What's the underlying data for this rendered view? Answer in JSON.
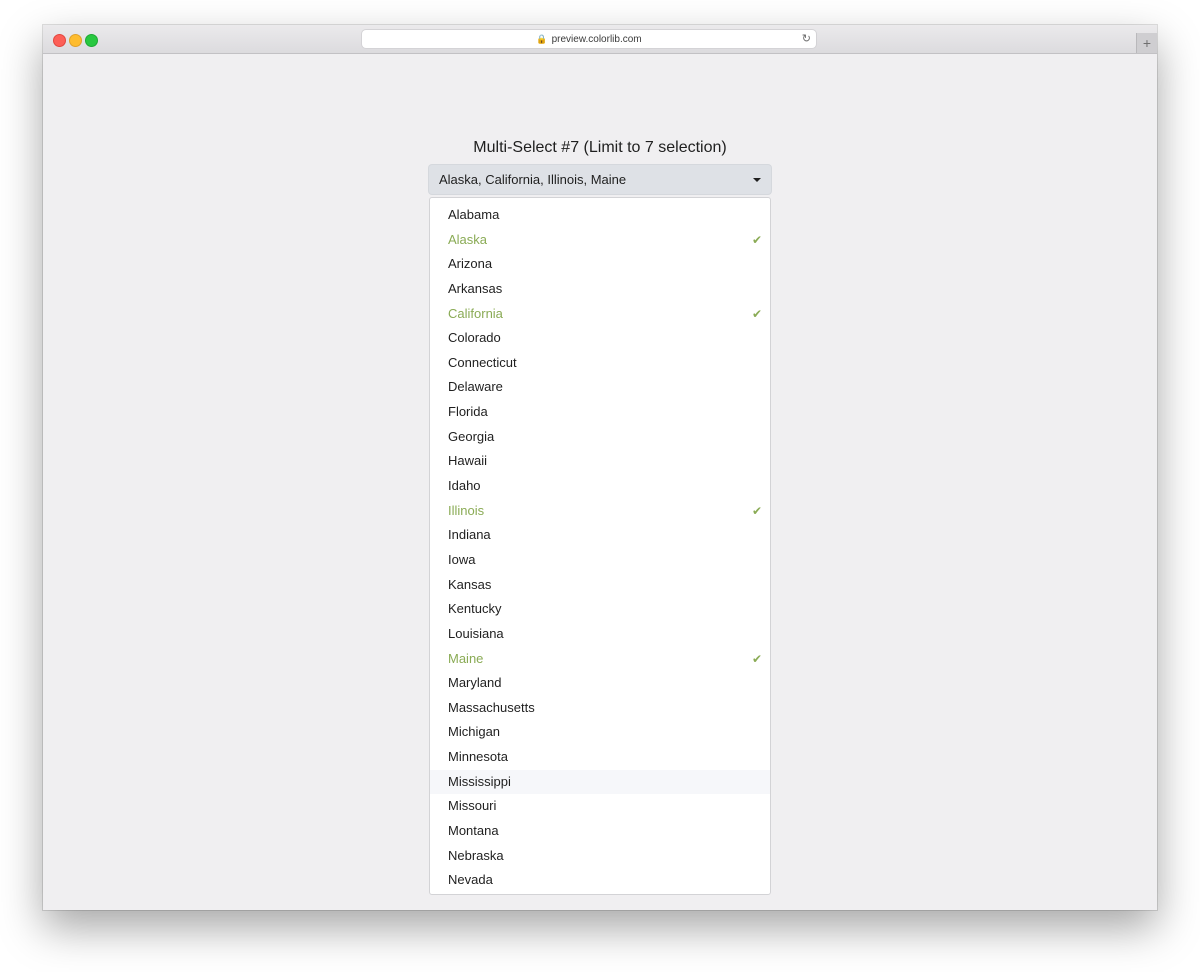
{
  "browser": {
    "url": "preview.colorlib.com",
    "lock_icon": "lock-icon",
    "reload_icon": "reload-icon",
    "newtab_label": "+"
  },
  "page": {
    "title": "Multi-Select #7 (Limit to 7 selection)"
  },
  "select": {
    "value": "Alaska, California, Illinois, Maine",
    "caret_icon": "caret-down-icon"
  },
  "options": [
    {
      "label": "Alabama",
      "selected": false
    },
    {
      "label": "Alaska",
      "selected": true
    },
    {
      "label": "Arizona",
      "selected": false
    },
    {
      "label": "Arkansas",
      "selected": false
    },
    {
      "label": "California",
      "selected": true
    },
    {
      "label": "Colorado",
      "selected": false
    },
    {
      "label": "Connecticut",
      "selected": false
    },
    {
      "label": "Delaware",
      "selected": false
    },
    {
      "label": "Florida",
      "selected": false
    },
    {
      "label": "Georgia",
      "selected": false
    },
    {
      "label": "Hawaii",
      "selected": false
    },
    {
      "label": "Idaho",
      "selected": false
    },
    {
      "label": "Illinois",
      "selected": true
    },
    {
      "label": "Indiana",
      "selected": false
    },
    {
      "label": "Iowa",
      "selected": false
    },
    {
      "label": "Kansas",
      "selected": false
    },
    {
      "label": "Kentucky",
      "selected": false
    },
    {
      "label": "Louisiana",
      "selected": false
    },
    {
      "label": "Maine",
      "selected": true
    },
    {
      "label": "Maryland",
      "selected": false
    },
    {
      "label": "Massachusetts",
      "selected": false
    },
    {
      "label": "Michigan",
      "selected": false
    },
    {
      "label": "Minnesota",
      "selected": false
    },
    {
      "label": "Mississippi",
      "selected": false,
      "hovered": true
    },
    {
      "label": "Missouri",
      "selected": false
    },
    {
      "label": "Montana",
      "selected": false
    },
    {
      "label": "Nebraska",
      "selected": false
    },
    {
      "label": "Nevada",
      "selected": false
    }
  ],
  "colors": {
    "selected": "#8aab55",
    "select_bg": "#dee1e6",
    "page_bg": "#f0eff1"
  }
}
